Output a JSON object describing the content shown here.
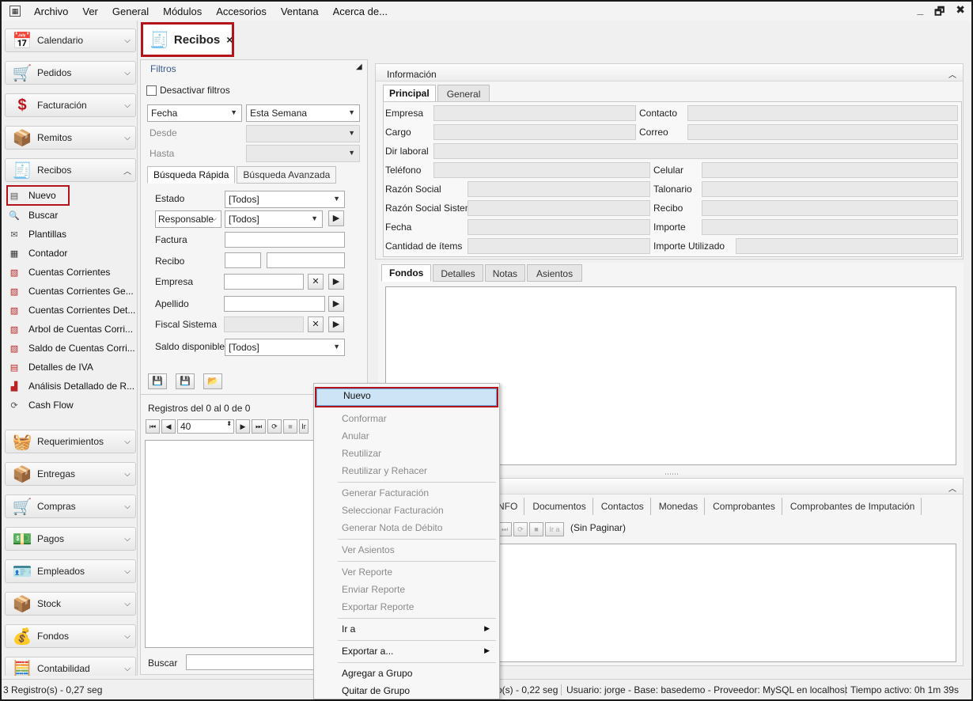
{
  "menu": [
    "Archivo",
    "Ver",
    "General",
    "Módulos",
    "Accesorios",
    "Ventana",
    "Acerca de..."
  ],
  "window_controls": {
    "minimize": "_",
    "restore": "🗗",
    "close": "✖"
  },
  "sidebar": {
    "groups_top": [
      {
        "label": "Calendario",
        "icon": "calendar-icon",
        "glyph": "📅"
      },
      {
        "label": "Pedidos",
        "icon": "cart-icon",
        "glyph": "🛒"
      },
      {
        "label": "Facturación",
        "icon": "dollar-icon",
        "glyph": "$"
      },
      {
        "label": "Remitos",
        "icon": "dolly-icon",
        "glyph": "📦"
      },
      {
        "label": "Recibos",
        "icon": "receipt-icon",
        "glyph": "🧾"
      }
    ],
    "recibos_items": [
      "Nuevo",
      "Buscar",
      "Plantillas",
      "Contador",
      "Cuentas Corrientes",
      "Cuentas Corrientes Ge...",
      "Cuentas Corrientes Det...",
      "Arbol de Cuentas Corri...",
      "Saldo de Cuentas Corri...",
      "Detalles de IVA",
      "Análisis Detallado de R...",
      "Cash Flow"
    ],
    "groups_bottom": [
      {
        "label": "Requerimientos",
        "icon": "basket-icon",
        "glyph": "🧺"
      },
      {
        "label": "Entregas",
        "icon": "delivery-icon",
        "glyph": "📦"
      },
      {
        "label": "Compras",
        "icon": "shopping-cart-icon",
        "glyph": "🛒"
      },
      {
        "label": "Pagos",
        "icon": "payment-icon",
        "glyph": "💵"
      },
      {
        "label": "Empleados",
        "icon": "employee-icon",
        "glyph": "🪪"
      },
      {
        "label": "Stock",
        "icon": "box-icon",
        "glyph": "📦"
      },
      {
        "label": "Fondos",
        "icon": "money-icon",
        "glyph": "💰"
      },
      {
        "label": "Contabilidad",
        "icon": "abacus-icon",
        "glyph": "🧮"
      }
    ]
  },
  "doc_tab": {
    "label": "Recibos",
    "close": "×"
  },
  "filters": {
    "title": "Filtros",
    "deactivate": "Desactivar filtros",
    "date_field": "Fecha",
    "date_range": "Esta Semana",
    "desde": "Desde",
    "hasta": "Hasta",
    "tabs": [
      "Búsqueda Rápida",
      "Búsqueda Avanzada"
    ],
    "estado_label": "Estado",
    "estado_value": "[Todos]",
    "responsable_label": "Responsable",
    "responsable_value": "[Todos]",
    "factura": "Factura",
    "recibo": "Recibo",
    "empresa": "Empresa",
    "apellido": "Apellido",
    "fiscal": "Fiscal Sistema",
    "saldo_label": "Saldo disponible",
    "saldo_value": "[Todos]",
    "registros": "Registros del 0 al 0 de 0",
    "page_size": "40",
    "buscar": "Buscar",
    "pager_partial": "Ir"
  },
  "info": {
    "title": "Información",
    "tabs": [
      "Principal",
      "General"
    ],
    "labels": {
      "empresa": "Empresa",
      "contacto": "Contacto",
      "cargo": "Cargo",
      "correo": "Correo",
      "dir": "Dir laboral",
      "telefono": "Teléfono",
      "celular": "Celular",
      "razon": "Razón Social",
      "talonario": "Talonario",
      "razon_sis": "Razón Social Sistema",
      "recibo": "Recibo",
      "fecha": "Fecha",
      "importe": "Importe",
      "cantidad": "Cantidad de ítems",
      "importe_util": "Importe Utilizado"
    }
  },
  "fondos_tabs": [
    "Fondos",
    "Detalles",
    "Notas",
    "Asientos"
  ],
  "bottom_tabs": [
    "NFO",
    "Documentos",
    "Contactos",
    "Monedas",
    "Comprobantes",
    "Comprobantes de Imputación"
  ],
  "bottom_pager": {
    "ir": "Ir a",
    "sin_paginar": "(Sin Paginar)"
  },
  "context_menu": {
    "items": [
      {
        "label": "Nuevo",
        "state": "hot"
      },
      {
        "label": "Conformar",
        "state": "dis"
      },
      {
        "label": "Anular",
        "state": "dis"
      },
      {
        "label": "Reutilizar",
        "state": "dis"
      },
      {
        "label": "Reutilizar y Rehacer",
        "state": "dis"
      },
      {
        "label": "Generar Facturación",
        "state": "dis"
      },
      {
        "label": "Seleccionar Facturación",
        "state": "dis"
      },
      {
        "label": "Generar Nota de Débito",
        "state": "dis"
      },
      {
        "label": "Ver Asientos",
        "state": "dis"
      },
      {
        "label": "Ver Reporte",
        "state": "dis"
      },
      {
        "label": "Enviar Reporte",
        "state": "dis"
      },
      {
        "label": "Exportar Reporte",
        "state": "dis"
      },
      {
        "label": "Ir a",
        "state": "sub"
      },
      {
        "label": "Exportar a...",
        "state": "sub"
      },
      {
        "label": "Agregar a Grupo",
        "state": "en"
      },
      {
        "label": "Quitar de Grupo",
        "state": "en"
      }
    ]
  },
  "status": {
    "left": "3 Registro(s) - 0,27 seg",
    "mid": "ro(s) - 0,22 seg",
    "user": "Usuario: jorge - Base: basedemo - Proveedor: MySQL en localhost",
    "time": "Tiempo activo: 0h 1m 39s"
  }
}
